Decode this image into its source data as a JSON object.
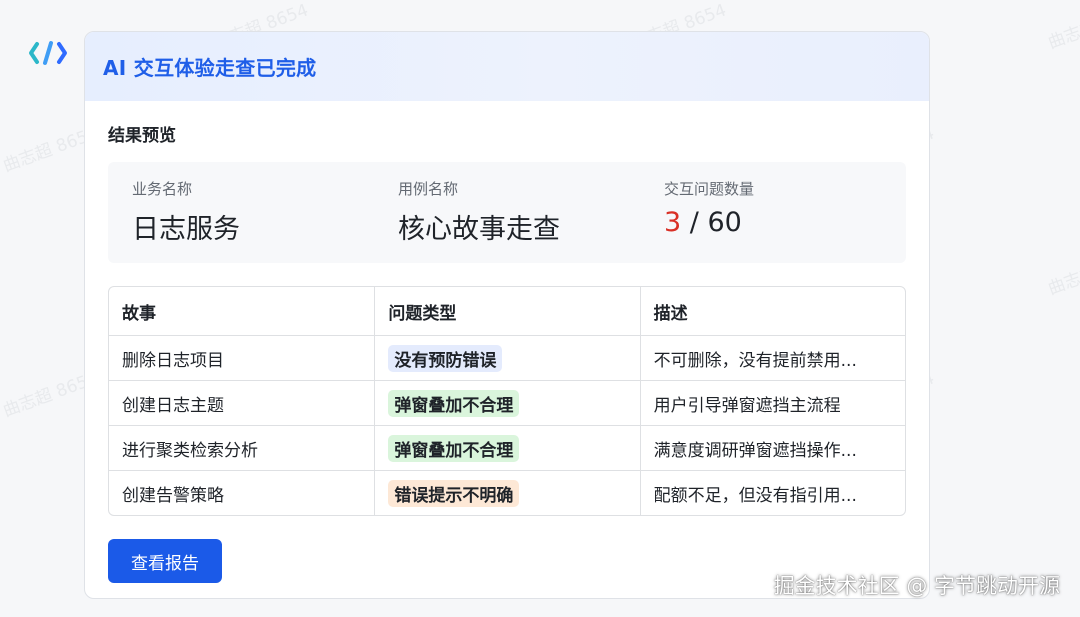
{
  "watermark": "曲志超 8654",
  "header": {
    "title": "AI 交互体验走查已完成"
  },
  "section_title": "结果预览",
  "summary": [
    {
      "label": "业务名称",
      "value": "日志服务"
    },
    {
      "label": "用例名称",
      "value": "核心故事走查"
    },
    {
      "label": "交互问题数量",
      "count": "3",
      "separator": "/",
      "total": "60"
    }
  ],
  "table": {
    "headers": [
      "故事",
      "问题类型",
      "描述"
    ],
    "rows": [
      {
        "story": "删除日志项目",
        "type": "没有预防错误",
        "type_color": "#e4ebfd",
        "description": "不可删除，没有提前禁用..."
      },
      {
        "story": "创建日志主题",
        "type": "弹窗叠加不合理",
        "type_color": "#daf5dc",
        "description": "用户引导弹窗遮挡主流程"
      },
      {
        "story": "进行聚类检索分析",
        "type": "弹窗叠加不合理",
        "type_color": "#daf5dc",
        "description": "满意度调研弹窗遮挡操作..."
      },
      {
        "story": "创建告警策略",
        "type": "错误提示不明确",
        "type_color": "#fde8d6",
        "description": "配额不足，但没有指引用..."
      }
    ]
  },
  "button": {
    "label": "查看报告"
  },
  "footer_credit": "掘金技术社区 @ 字节跳动开源",
  "colors": {
    "accent": "#1b5ae8",
    "highlight": "#d93026"
  }
}
